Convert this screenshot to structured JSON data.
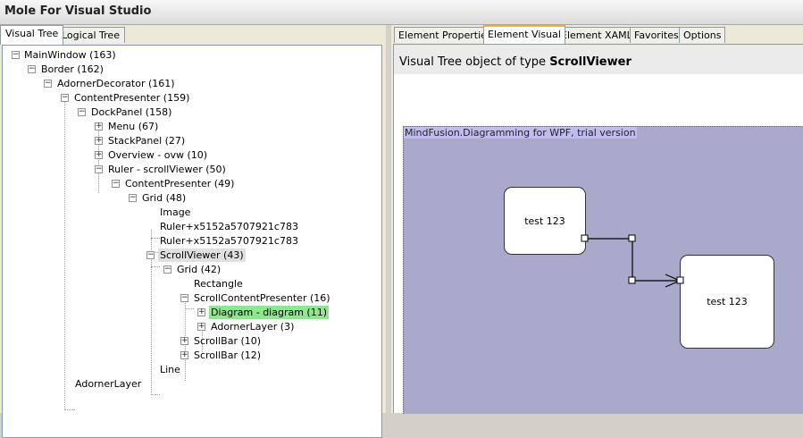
{
  "window": {
    "title": "Mole For Visual Studio"
  },
  "left_tabs": [
    "Visual Tree",
    "Logical Tree"
  ],
  "tree": [
    {
      "label": "MainWindow (163)",
      "expander": "-"
    },
    {
      "label": "Border (162)",
      "expander": "-"
    },
    {
      "label": "AdornerDecorator (161)",
      "expander": "-"
    },
    {
      "label": "ContentPresenter (159)",
      "expander": "-"
    },
    {
      "label": "DockPanel (158)",
      "expander": "-"
    },
    {
      "label": "Menu (67)",
      "expander": "+"
    },
    {
      "label": "StackPanel (27)",
      "expander": "+"
    },
    {
      "label": "Overview - ovw (10)",
      "expander": "+"
    },
    {
      "label": "Ruler - scrollViewer (50)",
      "expander": "-"
    },
    {
      "label": "ContentPresenter (49)",
      "expander": "-"
    },
    {
      "label": "Grid (48)",
      "expander": "-"
    },
    {
      "label": "Image",
      "expander": ""
    },
    {
      "label": "Ruler+x5152a5707921c783",
      "expander": ""
    },
    {
      "label": "Ruler+x5152a5707921c783",
      "expander": ""
    },
    {
      "label": "ScrollViewer (43)",
      "expander": "-"
    },
    {
      "label": "Grid (42)",
      "expander": "-"
    },
    {
      "label": "Rectangle",
      "expander": ""
    },
    {
      "label": "ScrollContentPresenter (16)",
      "expander": "-"
    },
    {
      "label": "Diagram - diagram (11)",
      "expander": "+"
    },
    {
      "label": "AdornerLayer (3)",
      "expander": "+"
    },
    {
      "label": "ScrollBar (10)",
      "expander": "+"
    },
    {
      "label": "ScrollBar (12)",
      "expander": "+"
    },
    {
      "label": "Line",
      "expander": ""
    },
    {
      "label": "AdornerLayer",
      "expander": ""
    }
  ],
  "right_tabs": [
    "Element Properties",
    "Element Visual",
    "Element XAML",
    "Favorites",
    "Options"
  ],
  "element_visual": {
    "prefix": "Visual Tree object of type ",
    "type_name": "ScrollViewer",
    "trial_notice": "MindFusion.Diagramming for WPF, trial version",
    "node1_label": "test 123",
    "node2_label": "test 123"
  },
  "colors": {
    "canvas_bg": "#a9a9cc",
    "selected_green": "#8ee68e",
    "active_tab_accent": "#f0b030"
  }
}
